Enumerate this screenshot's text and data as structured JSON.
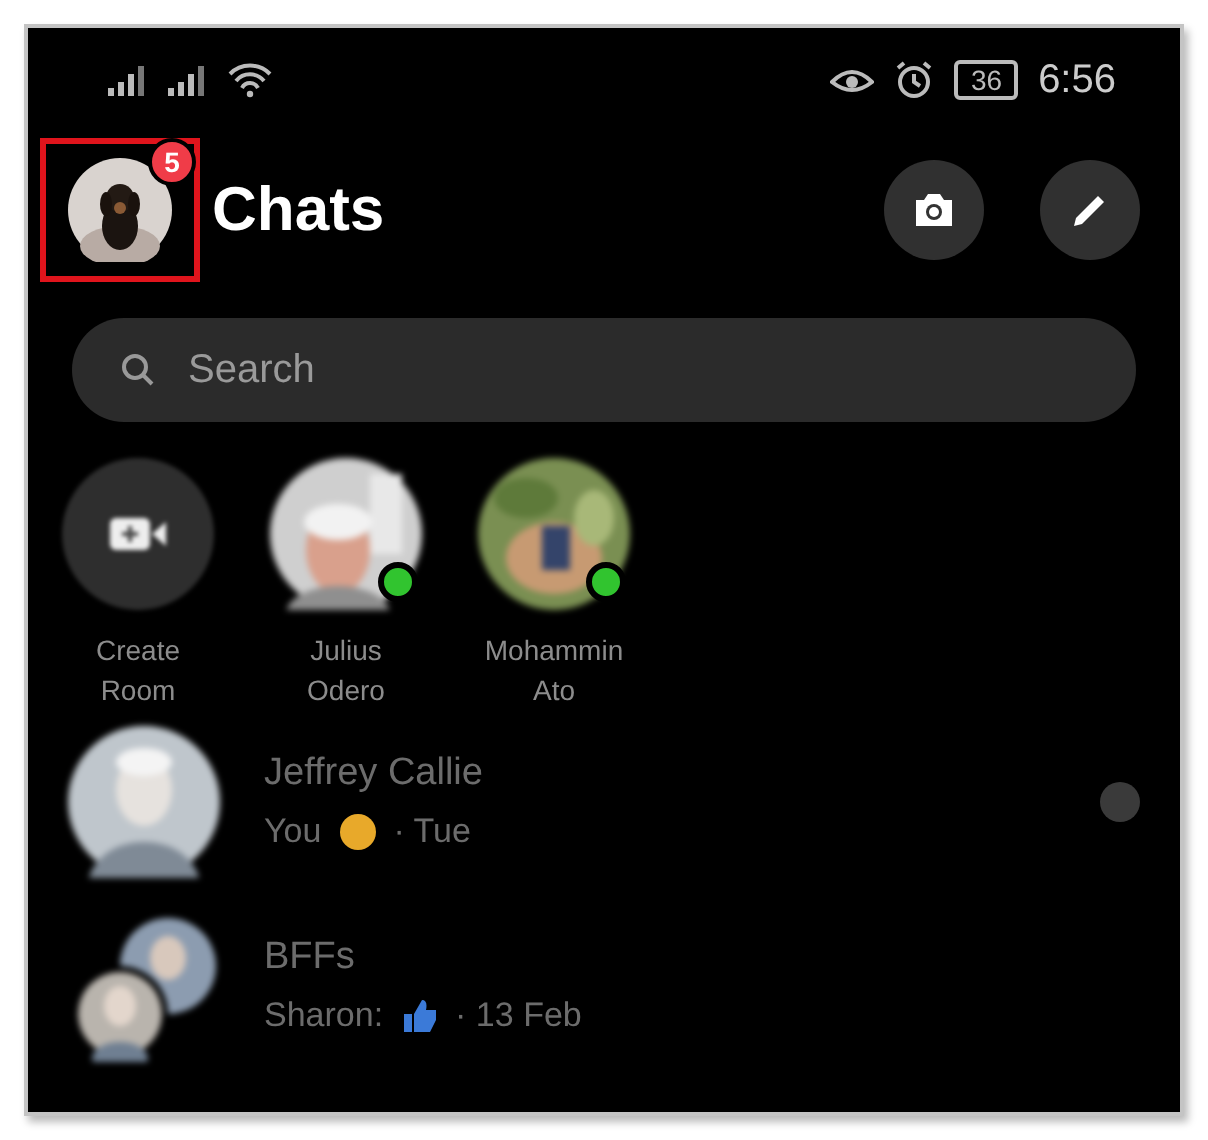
{
  "status_bar": {
    "battery": "36",
    "time": "6:56"
  },
  "header": {
    "title": "Chats",
    "badge": "5",
    "avatar_highlighted": true
  },
  "search": {
    "placeholder": "Search"
  },
  "stories": [
    {
      "kind": "create",
      "label": "Create Room",
      "online": false
    },
    {
      "kind": "person",
      "label": "Julius Odero",
      "online": true
    },
    {
      "kind": "person",
      "label": "Mohammin Ato",
      "online": true
    }
  ],
  "chats": [
    {
      "kind": "single",
      "name": "Jeffrey Callie",
      "sender": "You",
      "reaction": {
        "kind": "smile"
      },
      "time": "· Tue",
      "seen": true
    },
    {
      "kind": "group",
      "name": "BFFs",
      "sender": "Sharon:",
      "reaction": {
        "kind": "like"
      },
      "time": "· 13 Feb",
      "seen": false
    }
  ]
}
